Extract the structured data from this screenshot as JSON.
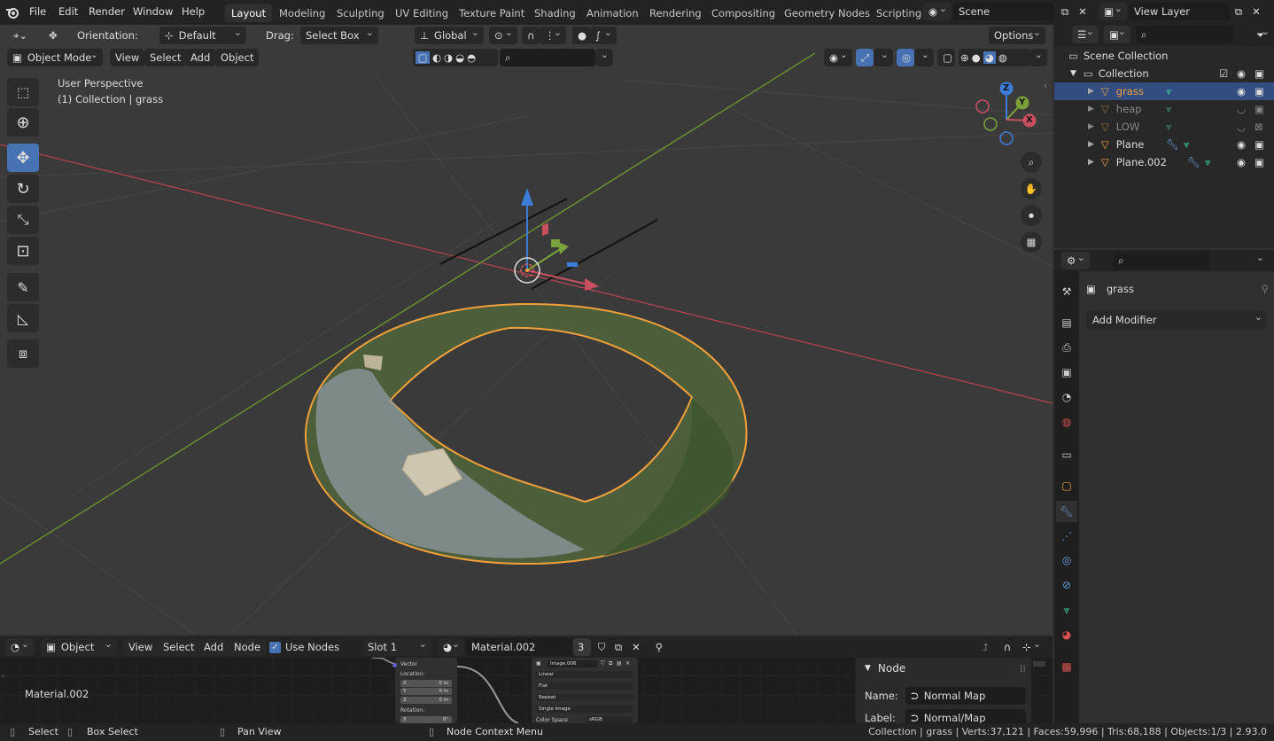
{
  "topbar": {
    "menus": [
      "File",
      "Edit",
      "Render",
      "Window",
      "Help"
    ],
    "workspaces": [
      "Layout",
      "Modeling",
      "Sculpting",
      "UV Editing",
      "Texture Paint",
      "Shading",
      "Animation",
      "Rendering",
      "Compositing",
      "Geometry Nodes",
      "Scripting"
    ],
    "scene": "Scene",
    "view_layer": "View Layer"
  },
  "viewport_header": {
    "orientation_label": "Orientation:",
    "orientation_value": "Default",
    "drag_label": "Drag:",
    "drag_value": "Select Box",
    "transform_space": "Global",
    "options": "Options",
    "mode": "Object Mode",
    "menus": [
      "View",
      "Select",
      "Add",
      "Object"
    ]
  },
  "viewport": {
    "perspective": "User Perspective",
    "collection_info": "(1) Collection | grass",
    "gizmo_axes": [
      "Z",
      "Y",
      "X"
    ]
  },
  "outliner": {
    "root": "Scene Collection",
    "collection": "Collection",
    "items": [
      {
        "name": "grass",
        "state": "selected"
      },
      {
        "name": "heap",
        "state": "hidden"
      },
      {
        "name": "LOW",
        "state": "hidden"
      },
      {
        "name": "Plane",
        "state": "normal"
      },
      {
        "name": "Plane.002",
        "state": "normal"
      }
    ]
  },
  "properties": {
    "object_name": "grass",
    "add_modifier": "Add Modifier"
  },
  "node_editor": {
    "header": {
      "editor_type": "Object",
      "menus": [
        "View",
        "Select",
        "Add",
        "Node"
      ],
      "use_nodes": "Use Nodes",
      "slot": "Slot 1",
      "material": "Material.002",
      "users": "3"
    },
    "material_label": "Material.002",
    "mapping_node": {
      "vector": "Vector",
      "location": "Location:",
      "x": "X",
      "y": "Y",
      "z": "Z",
      "x_val": "0 m",
      "y_val": "0 m",
      "z_val": "0 m",
      "rotation": "Rotation:",
      "rx": "X",
      "rx_val": "0°"
    },
    "image_node": {
      "image": "Image.006",
      "interp": "Linear",
      "proj": "Flat",
      "ext": "Repeat",
      "source": "Single Image",
      "colorspace_label": "Color Space",
      "colorspace": "sRGB"
    },
    "sidebar": {
      "panel": "Node",
      "name_label": "Name:",
      "name_value": "Normal Map",
      "label_label": "Label:",
      "label_value": "Normal/Map"
    }
  },
  "statusbar": {
    "select": "Select",
    "box_select": "Box Select",
    "pan_view": "Pan View",
    "context_menu": "Node Context Menu",
    "stats": "Collection | grass | Verts:37,121 | Faces:59,996 | Tris:68,188 | Objects:1/3 | 2.93.0"
  },
  "colors": {
    "accent": "#4772b3",
    "selection_outline": "#f2a13a",
    "x_axis": "#c8505f",
    "y_axis": "#7ba23a",
    "z_axis": "#3d7cd9"
  }
}
